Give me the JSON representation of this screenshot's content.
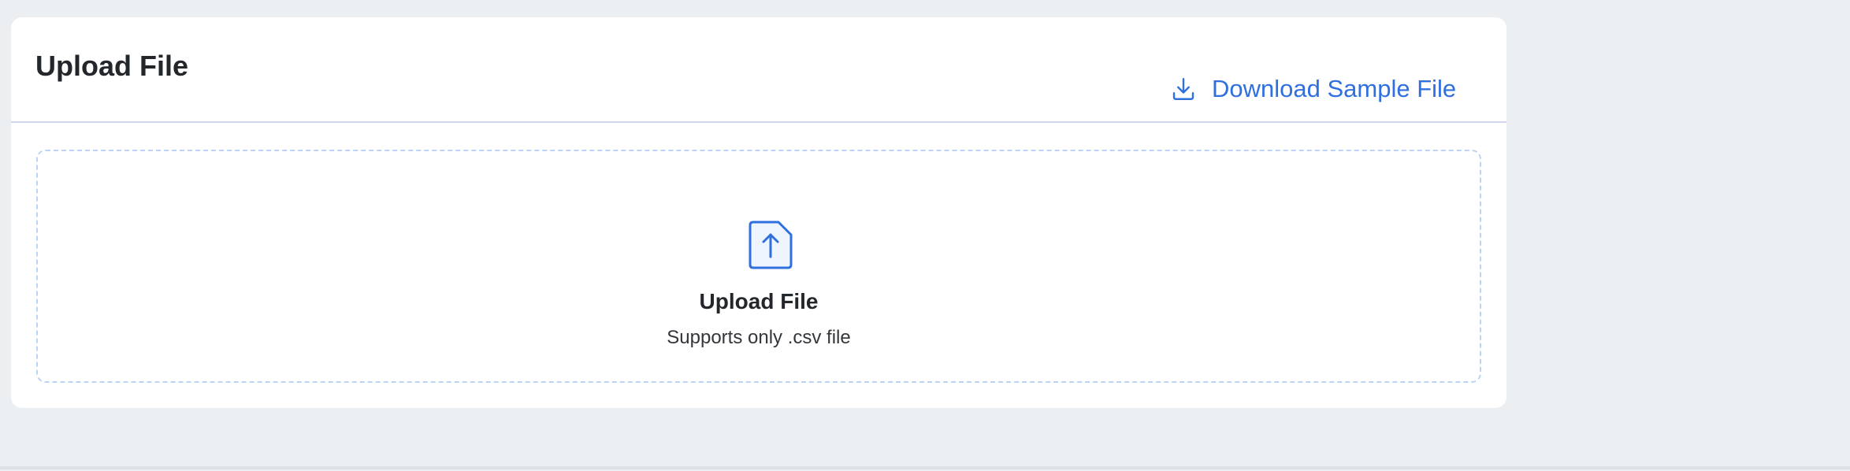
{
  "card": {
    "title": "Upload File",
    "download_label": "Download Sample File"
  },
  "dropzone": {
    "title": "Upload File",
    "subtitle": "Supports only .csv file"
  },
  "colors": {
    "accent": "#2f6fdf",
    "background": "#ebeff2",
    "card": "#ffffff",
    "dropzone_border": "#bcd3f5",
    "divider": "#d0d5ee",
    "text": "#23262b"
  },
  "icons": {
    "download": "download-icon",
    "file_upload": "file-upload-icon"
  }
}
